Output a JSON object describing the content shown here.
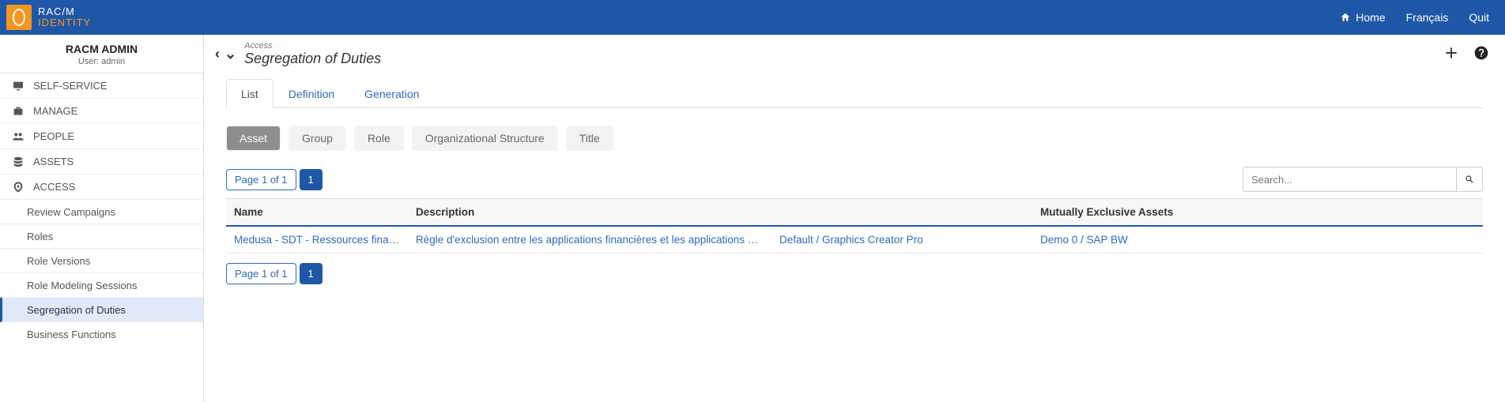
{
  "brand": {
    "line1": "RAC/M",
    "line2": "IDENTITY"
  },
  "topnav": {
    "home": "Home",
    "lang": "Français",
    "quit": "Quit"
  },
  "sidebar": {
    "title": "RACM ADMIN",
    "user": "User: admin",
    "groups": [
      {
        "label": "SELF-SERVICE"
      },
      {
        "label": "MANAGE"
      },
      {
        "label": "PEOPLE"
      },
      {
        "label": "ASSETS"
      },
      {
        "label": "ACCESS"
      }
    ],
    "access_items": [
      {
        "label": "Review Campaigns"
      },
      {
        "label": "Roles"
      },
      {
        "label": "Role Versions"
      },
      {
        "label": "Role Modeling Sessions"
      },
      {
        "label": "Segregation of Duties"
      },
      {
        "label": "Business Functions"
      }
    ]
  },
  "page": {
    "crumb": "Access",
    "title": "Segregation of Duties"
  },
  "tabs": {
    "list": "List",
    "definition": "Definition",
    "generation": "Generation"
  },
  "filters": {
    "asset": "Asset",
    "group": "Group",
    "role": "Role",
    "org": "Organizational Structure",
    "title": "Title"
  },
  "pager": {
    "label": "Page 1 of 1",
    "num": "1"
  },
  "search": {
    "placeholder": "Search..."
  },
  "table": {
    "headers": {
      "name": "Name",
      "desc": "Description",
      "mid": "",
      "mex": "Mutually Exclusive Assets"
    },
    "rows": [
      {
        "name": "Medusa - SDT - Ressources financières",
        "desc": "Règle d'exclusion entre les applications financières et les applications métiers",
        "mid": "Default / Graphics Creator Pro",
        "mex": "Demo 0 / SAP BW"
      }
    ]
  }
}
